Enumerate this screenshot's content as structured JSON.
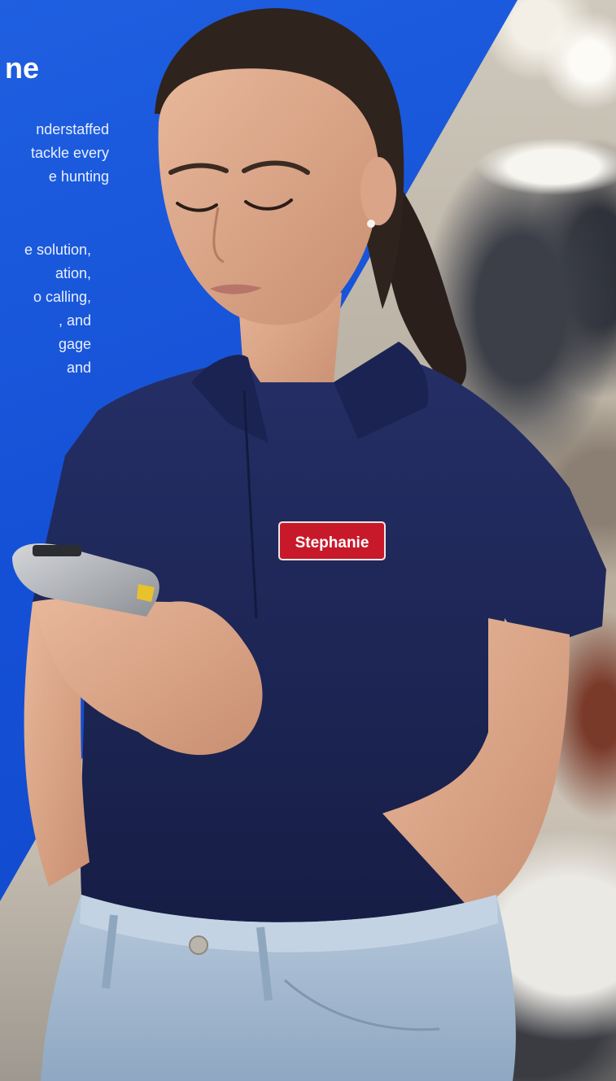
{
  "hero": {
    "headline_fragment": "ne",
    "paragraph1_lines": [
      "nderstaffed",
      "tackle every",
      "e hunting"
    ],
    "paragraph2_lines": [
      "e solution,",
      "ation,",
      "o calling,",
      ", and",
      "gage",
      "and"
    ]
  },
  "name_tag": {
    "text": "Stephanie"
  },
  "colors": {
    "brand_blue": "#1450d6",
    "polo_navy": "#1c2555",
    "name_tag_red": "#c8192a",
    "jeans": "#a9bfd6"
  }
}
